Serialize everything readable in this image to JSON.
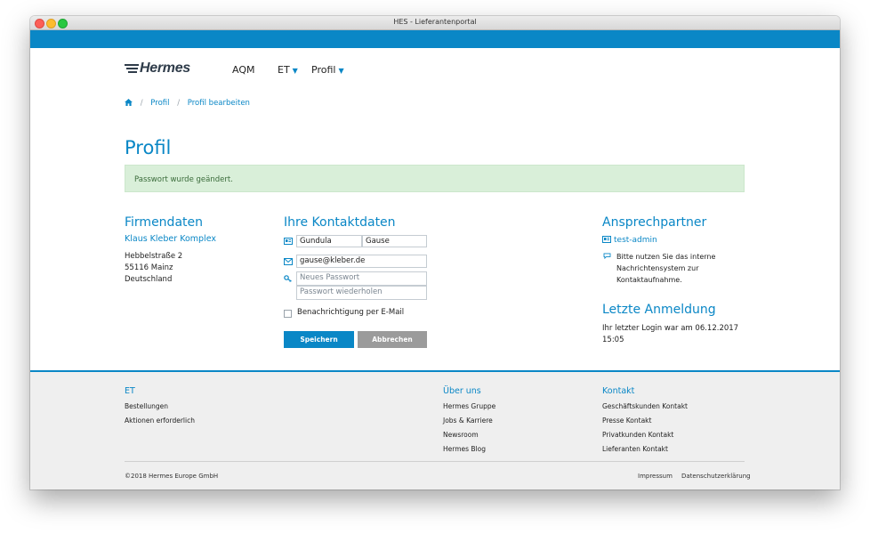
{
  "window": {
    "title": "HES - Lieferantenportal"
  },
  "nav": {
    "logo": "Hermes",
    "items": [
      {
        "label": "AQM",
        "chevron": false
      },
      {
        "label": "ET",
        "chevron": true
      },
      {
        "label": "Profil",
        "chevron": true
      }
    ]
  },
  "breadcrumb": {
    "items": [
      "Profil",
      "Profil bearbeiten"
    ],
    "separator": "/"
  },
  "page": {
    "title": "Profil"
  },
  "alert": {
    "text": "Passwort wurde geändert."
  },
  "company": {
    "heading": "Firmendaten",
    "name": "Klaus Kleber Komplex",
    "street": "Hebbelstraße 2",
    "city": "55116 Mainz",
    "country": "Deutschland"
  },
  "contact": {
    "heading": "Ihre Kontaktdaten",
    "first_name": "Gundula",
    "last_name": "Gause",
    "email": "gause@kleber.de",
    "new_password_placeholder": "Neues Passwort",
    "repeat_password_placeholder": "Passwort wiederholen",
    "notify_label": "Benachrichtigung per E-Mail",
    "notify_checked": false,
    "save_label": "Speichern",
    "cancel_label": "Abbrechen"
  },
  "partner": {
    "heading": "Ansprechpartner",
    "user": "test-admin",
    "note": "Bitte nutzen Sie das interne Nachrichtensystem zur Kontaktaufnahme."
  },
  "last_login": {
    "heading": "Letzte Anmeldung",
    "text": "Ihr letzter Login war am 06.12.2017 15:05"
  },
  "footer": {
    "col1": {
      "heading": "ET",
      "links": [
        "Bestellungen",
        "Aktionen erforderlich"
      ]
    },
    "col2": {
      "heading": "Über uns",
      "links": [
        "Hermes Gruppe",
        "Jobs & Karriere",
        "Newsroom",
        "Hermes Blog"
      ]
    },
    "col3": {
      "heading": "Kontakt",
      "links": [
        "Geschäftskunden Kontakt",
        "Presse Kontakt",
        "Privatkunden Kontakt",
        "Lieferanten Kontakt"
      ]
    },
    "copyright": "©2018 Hermes Europe GmbH",
    "legal": [
      "Impressum",
      "Datenschutzerklärung"
    ]
  },
  "colors": {
    "accent": "#0a87c6",
    "success_bg": "#d9efd9",
    "secondary_button": "#9b9b9b"
  }
}
